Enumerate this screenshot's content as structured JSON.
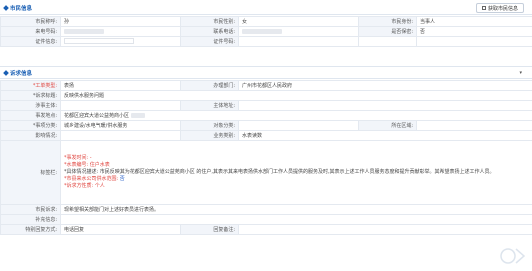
{
  "citizen": {
    "title": "市民信息",
    "fetch_button": "获取市民信息",
    "fields": {
      "name_label": "市民称呼:",
      "name_value": "孙",
      "gender_label": "市民性别:",
      "gender_value": "女",
      "identity_label": "市民身份:",
      "identity_value": "当事人",
      "caller_label": "来电号码:",
      "contact_label": "联系电话:",
      "confidential_label": "是否保密:",
      "confidential_value": "否",
      "idtype_label": "证件信息:",
      "idno_label": "证件号码:"
    }
  },
  "appeal": {
    "title": "诉求信息",
    "collapse_icon": "chevron-down-icon",
    "fields": {
      "type_label": "*工单类型:",
      "type_value": "表扬",
      "dept_label": "办理部门:",
      "dept_value": "广州市花都区人民政府",
      "topic_label": "*诉求标题:",
      "topic_value": "反映供水服务问题",
      "subject_label": "涉事主体:",
      "addr_label": "主体地址:",
      "place_label": "事发地点:",
      "place_value": "花都区迎宾大道公益苑商小区",
      "cat_label": "*事项分类:",
      "cat_value": "城乡建设/水电气暖/供水服务",
      "objcat_label": "对象分类:",
      "area_label": "所在区域:",
      "impact_label": "影响情况:",
      "biz_label": "业务类别:",
      "biz_value": "水表读数",
      "content_label": "标签栏:",
      "line1": "*事发时间: -",
      "line2": "*水表编号: 住户水表",
      "line3": "*具体情况描述: 市民反映其为花都区迎宾大道公益苑商小区                的住户,其表示其来电表扬供水部门工作人员提供的服务及时,其表示上述工作人员服务态度和提升贡献彰举。其希望表扬上述工作人员。",
      "line4_prefix": "*市县来水公司供水范围:",
      "line4_value": "否",
      "line5": "*诉求方性质: 个人",
      "request_label": "市民诉求:",
      "request_value": "现希望相关部能门对上述好表员进行表扬。",
      "extra_label": "补充信息:",
      "reply_label": "特别回复方式:",
      "reply_value": "电话回复",
      "remark_label": "回复备注:"
    }
  }
}
